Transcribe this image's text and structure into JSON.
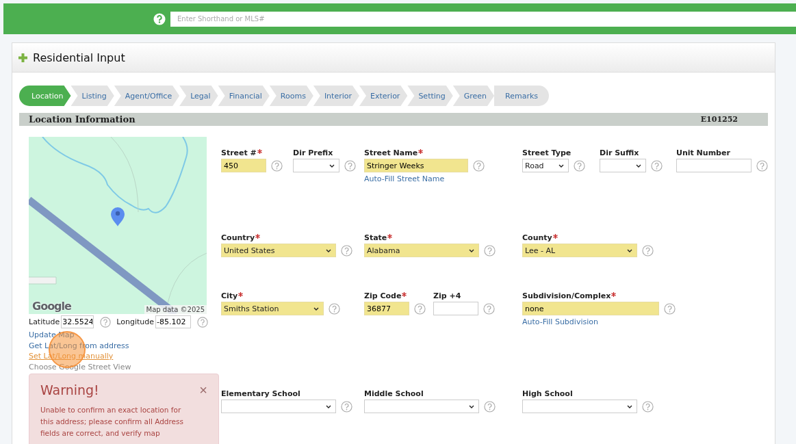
{
  "topbar": {
    "search": {
      "placeholder": "Enter Shorthand or MLS#"
    }
  },
  "panel": {
    "title": "Residential Input"
  },
  "tabs": [
    {
      "label": "Location",
      "selected": true
    },
    {
      "label": "Listing",
      "selected": false
    },
    {
      "label": "Agent/Office",
      "selected": false
    },
    {
      "label": "Legal",
      "selected": false
    },
    {
      "label": "Financial",
      "selected": false
    },
    {
      "label": "Rooms",
      "selected": false
    },
    {
      "label": "Interior",
      "selected": false
    },
    {
      "label": "Exterior",
      "selected": false
    },
    {
      "label": "Setting",
      "selected": false
    },
    {
      "label": "Green",
      "selected": false
    },
    {
      "label": "Remarks",
      "selected": false
    }
  ],
  "section": {
    "title": "Location Information",
    "id": "E101252"
  },
  "map": {
    "logo": "Google",
    "attribution": "Map data ©2025"
  },
  "coordinates": [
    {
      "label": "Latitude",
      "value": "32.5524"
    },
    {
      "label": "Longitude",
      "value": "-85.102"
    }
  ],
  "map_links": [
    {
      "label": "Update Map",
      "kind": "link"
    },
    {
      "label": "Get Lat/Long from address",
      "kind": "link"
    },
    {
      "label": "Set Lat/Long manually",
      "kind": "hover"
    },
    {
      "label": "Choose Google Street View",
      "kind": "muted"
    }
  ],
  "warning": {
    "title": "Warning!",
    "close": "×",
    "message": "Unable to confirm an exact location for this address; please confirm all Address fields are correct, and verify map"
  },
  "field_rows": [
    [
      {
        "label": "Street #",
        "required": true,
        "kind": "text",
        "value": "450"
      },
      {
        "label": "Dir Prefix",
        "required": false,
        "kind": "select"
      },
      {
        "label": "Street Name",
        "required": true,
        "kind": "text",
        "value": "Stringer Weeks",
        "link": "Auto-Fill Street Name"
      },
      {
        "label": "Street Type",
        "required": false,
        "kind": "select",
        "value": "Road"
      },
      {
        "label": "Dir Suffix",
        "required": false,
        "kind": "select"
      },
      {
        "label": "Unit Number",
        "required": false,
        "kind": "text"
      }
    ],
    [
      {
        "label": "Country",
        "required": true,
        "kind": "select",
        "value": "United States"
      },
      {
        "label": "State",
        "required": true,
        "kind": "select",
        "value": "Alabama"
      },
      {
        "label": "County",
        "required": true,
        "kind": "select",
        "value": "Lee - AL"
      }
    ],
    [
      {
        "label": "City",
        "required": true,
        "kind": "select",
        "value": "Smiths Station"
      },
      {
        "label": "Zip Code",
        "required": true,
        "kind": "text",
        "value": "36877"
      },
      {
        "label": "Zip +4",
        "required": false,
        "kind": "text"
      },
      {
        "label": "Subdivision/Complex",
        "required": true,
        "kind": "text",
        "value": "none",
        "link": "Auto-Fill Subdivision"
      }
    ],
    [
      {
        "label": "Elementary School",
        "required": false,
        "kind": "select"
      },
      {
        "label": "Middle School",
        "required": false,
        "kind": "select"
      },
      {
        "label": "High School",
        "required": false,
        "kind": "select"
      }
    ]
  ]
}
